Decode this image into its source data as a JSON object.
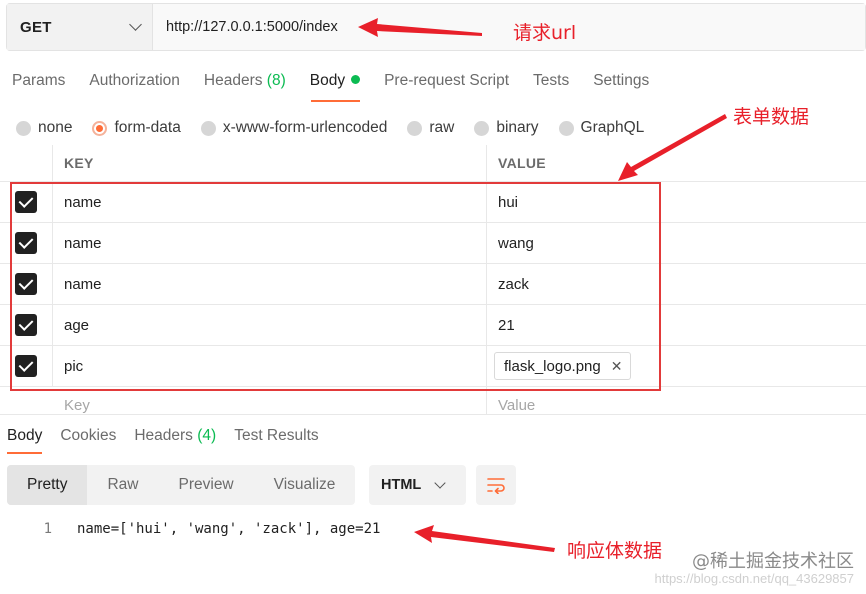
{
  "request": {
    "method": "GET",
    "url": "http://127.0.0.1:5000/index"
  },
  "request_tabs": [
    {
      "label": "Params"
    },
    {
      "label": "Authorization"
    },
    {
      "label": "Headers",
      "count": "(8)"
    },
    {
      "label": "Body",
      "active": true,
      "indicator": "green-dot"
    },
    {
      "label": "Pre-request Script"
    },
    {
      "label": "Tests"
    },
    {
      "label": "Settings"
    }
  ],
  "body_types": [
    {
      "label": "none",
      "checked": false
    },
    {
      "label": "form-data",
      "checked": true
    },
    {
      "label": "x-www-form-urlencoded",
      "checked": false
    },
    {
      "label": "raw",
      "checked": false
    },
    {
      "label": "binary",
      "checked": false
    },
    {
      "label": "GraphQL",
      "checked": false
    }
  ],
  "form_table": {
    "headers": {
      "key": "KEY",
      "value": "VALUE"
    },
    "rows": [
      {
        "key": "name",
        "value": "hui",
        "checked": true
      },
      {
        "key": "name",
        "value": "wang",
        "checked": true
      },
      {
        "key": "name",
        "value": "zack",
        "checked": true
      },
      {
        "key": "age",
        "value": "21",
        "checked": true
      },
      {
        "key": "pic",
        "value": "flask_logo.png",
        "checked": true,
        "is_file": true,
        "remove_icon": "close-icon"
      }
    ],
    "placeholder": {
      "key": "Key",
      "value": "Value"
    }
  },
  "response_tabs": [
    {
      "label": "Body",
      "active": true
    },
    {
      "label": "Cookies"
    },
    {
      "label": "Headers",
      "count": "(4)"
    },
    {
      "label": "Test Results"
    }
  ],
  "response_view": {
    "modes": [
      "Pretty",
      "Raw",
      "Preview",
      "Visualize"
    ],
    "active_mode": "Pretty",
    "language": "HTML",
    "wrap_icon": "wrap-lines-icon"
  },
  "response_body": {
    "lines": [
      {
        "number": "1",
        "text": "name=['hui', 'wang', 'zack'], age=21"
      }
    ]
  },
  "annotations": {
    "url_label": "请求url",
    "form_label": "表单数据",
    "response_label": "响应体数据",
    "color": "#e8202a"
  },
  "watermark": {
    "primary": "@稀土掘金技术社区",
    "secondary": "https://blog.csdn.net/qq_43629857"
  },
  "colors": {
    "accent": "#ff6c37",
    "count_green": "#0cbb52"
  }
}
